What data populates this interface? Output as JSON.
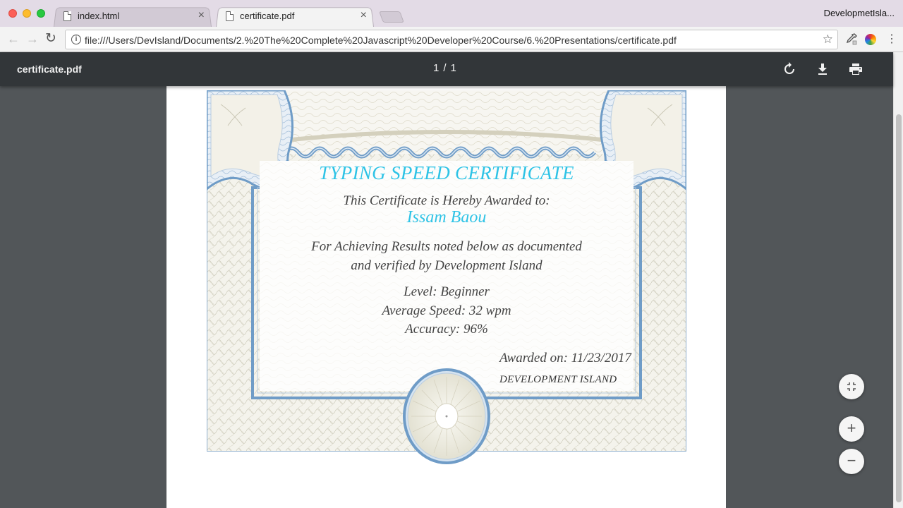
{
  "window": {
    "profile_label": "DevelopmetIsla..."
  },
  "tabs": [
    {
      "title": "index.html",
      "close": "×"
    },
    {
      "title": "certificate.pdf",
      "close": "×"
    }
  ],
  "toolbar": {
    "url": "file:///Users/DevIsland/Documents/2.%20The%20Complete%20Javascript%20Developer%20Course/6.%20Presentations/certificate.pdf",
    "back_glyph": "←",
    "forward_glyph": "→",
    "reload_glyph": "↻",
    "info_glyph": "i",
    "star_glyph": "☆",
    "menu_glyph": "⋮"
  },
  "pdf_viewer": {
    "file_name": "certificate.pdf",
    "current_page": "1",
    "page_separator": "/",
    "total_pages": "1",
    "zoom_in_glyph": "+",
    "zoom_out_glyph": "−",
    "fit_glyph": "⤡"
  },
  "certificate": {
    "title": "TYPING SPEED CERTIFICATE",
    "awarded_to_line": "This Certificate is Hereby Awarded to:",
    "recipient": "Issam Baou",
    "purpose_line1": "For Achieving Results noted below as documented",
    "purpose_line2": "and verified by Development Island",
    "level": "Level: Beginner",
    "speed": "Average Speed: 32 wpm",
    "accuracy": "Accuracy: 96%",
    "awarded_on": "Awarded on: 11/23/2017",
    "organization": "DEVELOPMENT ISLAND"
  },
  "colors": {
    "accent_cyan": "#2ec3e6",
    "border_blue": "#6f9cc7",
    "guilloche_beige": "#d8d6c8",
    "pdf_toolbar": "#323639",
    "viewer_bg": "#525659"
  },
  "icons": {
    "rotate": "rotate-icon",
    "download": "download-icon",
    "print": "print-icon",
    "file": "file-icon",
    "star": "star-icon",
    "info": "info-icon"
  }
}
